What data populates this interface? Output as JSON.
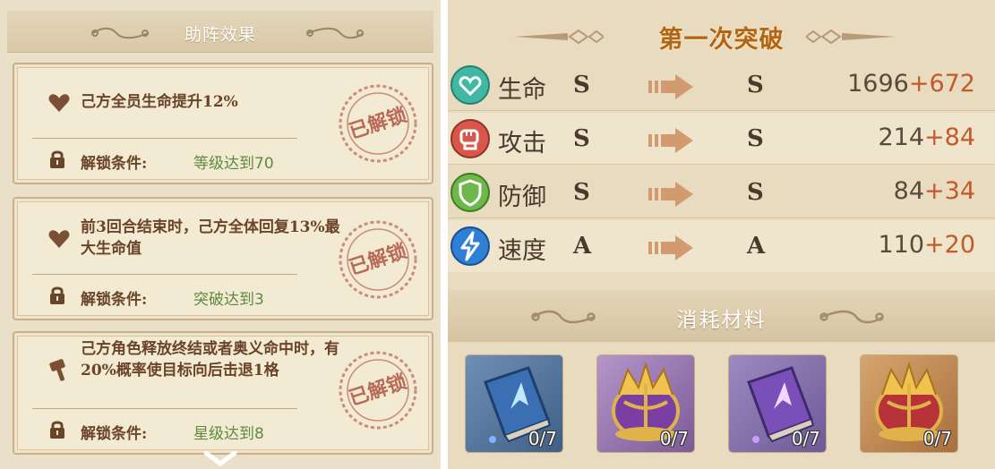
{
  "left": {
    "header_title": "助阵效果",
    "cards": [
      {
        "effect": "己方全员生命提升12%",
        "condition_label": "解锁条件:",
        "condition_value": "等级达到70",
        "stamp_text": "已解锁",
        "icon": "heart-icon"
      },
      {
        "effect": "前3回合结束时，己方全体回复13%最大生命值",
        "condition_label": "解锁条件:",
        "condition_value": "突破达到3",
        "stamp_text": "已解锁",
        "icon": "heart-icon"
      },
      {
        "effect": "己方角色释放终结或者奥义命中时，有20%概率使目标向后击退1格",
        "condition_label": "解锁条件:",
        "condition_value": "星级达到8",
        "stamp_text": "已解锁",
        "icon": "hammer-icon"
      }
    ]
  },
  "right": {
    "title": "第一次突破",
    "stats": [
      {
        "name": "生命",
        "from": "S",
        "to": "S",
        "base": "1696",
        "bonus": "+672",
        "icon": "heart-icon",
        "color": "#3fb9a4"
      },
      {
        "name": "攻击",
        "from": "S",
        "to": "S",
        "base": "214",
        "bonus": "+84",
        "icon": "fist-icon",
        "color": "#d9574a"
      },
      {
        "name": "防御",
        "from": "S",
        "to": "S",
        "base": "84",
        "bonus": "+34",
        "icon": "shield-icon",
        "color": "#6cb84a"
      },
      {
        "name": "速度",
        "from": "A",
        "to": "A",
        "base": "110",
        "bonus": "+20",
        "icon": "lightning-icon",
        "color": "#2f7fd6"
      }
    ],
    "materials_title": "消耗材料",
    "materials": [
      {
        "name": "blue-book-icon",
        "count": "0/7"
      },
      {
        "name": "purple-crown-icon",
        "count": "0/7"
      },
      {
        "name": "purple-book-icon",
        "count": "0/7"
      },
      {
        "name": "red-crown-icon",
        "count": "0/7"
      }
    ]
  },
  "colors": {
    "accent_orange": "#b26518",
    "condition_green": "#5e8a3e",
    "bonus_red": "#c25a2a",
    "stamp_red": "#b96a56"
  }
}
